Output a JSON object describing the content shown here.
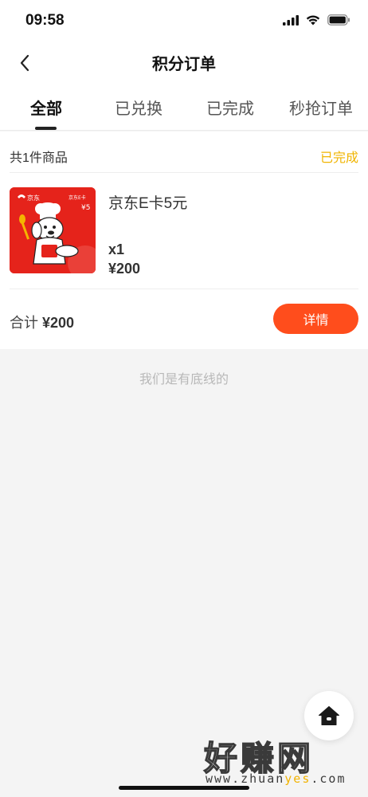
{
  "status_bar": {
    "time": "09:58"
  },
  "nav": {
    "title": "积分订单"
  },
  "tabs": [
    {
      "label": "全部",
      "active": true
    },
    {
      "label": "已兑换",
      "active": false
    },
    {
      "label": "已完成",
      "active": false
    },
    {
      "label": "秒抢订单",
      "active": false
    }
  ],
  "order": {
    "item_count": "共1件商品",
    "status": "已完成",
    "product": {
      "name": "京东E卡5元",
      "quantity": "x1",
      "price": "¥200",
      "image": {
        "brand_text": "京东",
        "card_label": "京东E卡",
        "value_text": "¥5"
      }
    },
    "total_label": "合计",
    "total_value": "¥200",
    "detail_button": "详情"
  },
  "footer_text": "我们是有底线的",
  "watermark": {
    "main": "好赚网",
    "sub_prefix": "www.zhuan",
    "sub_highlight": "yes",
    "sub_suffix": ".com"
  },
  "colors": {
    "accent": "#ff4d1c",
    "status": "#f0b400",
    "card_red": "#e5231b"
  },
  "icons": {
    "back": "chevron-left-icon",
    "home": "home-icon"
  }
}
